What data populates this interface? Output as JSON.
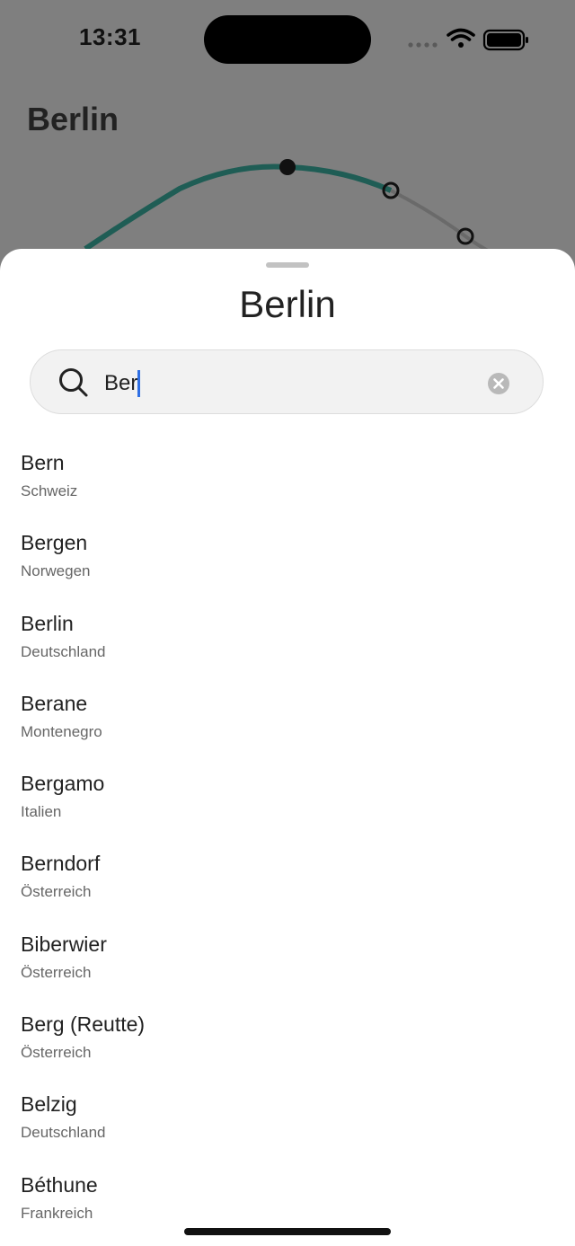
{
  "status_bar": {
    "time": "13:31"
  },
  "background": {
    "title": "Berlin"
  },
  "sheet": {
    "title": "Berlin",
    "search": {
      "value": "Ber",
      "placeholder": ""
    },
    "results": [
      {
        "name": "Bern",
        "country": "Schweiz"
      },
      {
        "name": "Bergen",
        "country": "Norwegen"
      },
      {
        "name": "Berlin",
        "country": "Deutschland"
      },
      {
        "name": "Berane",
        "country": "Montenegro"
      },
      {
        "name": "Bergamo",
        "country": "Italien"
      },
      {
        "name": "Berndorf",
        "country": "Österreich"
      },
      {
        "name": "Biberwier",
        "country": "Österreich"
      },
      {
        "name": "Berg (Reutte)",
        "country": "Österreich"
      },
      {
        "name": "Belzig",
        "country": "Deutschland"
      },
      {
        "name": "Béthune",
        "country": "Frankreich"
      }
    ]
  },
  "colors": {
    "accent_curve": "#1f5d55",
    "caret": "#2f6fe4",
    "dim_overlay": "#7f7f7f"
  },
  "icons": {
    "search": "search-icon",
    "clear": "clear-icon",
    "wifi": "wifi-icon",
    "battery": "battery-icon",
    "signal": "signal-icon"
  }
}
